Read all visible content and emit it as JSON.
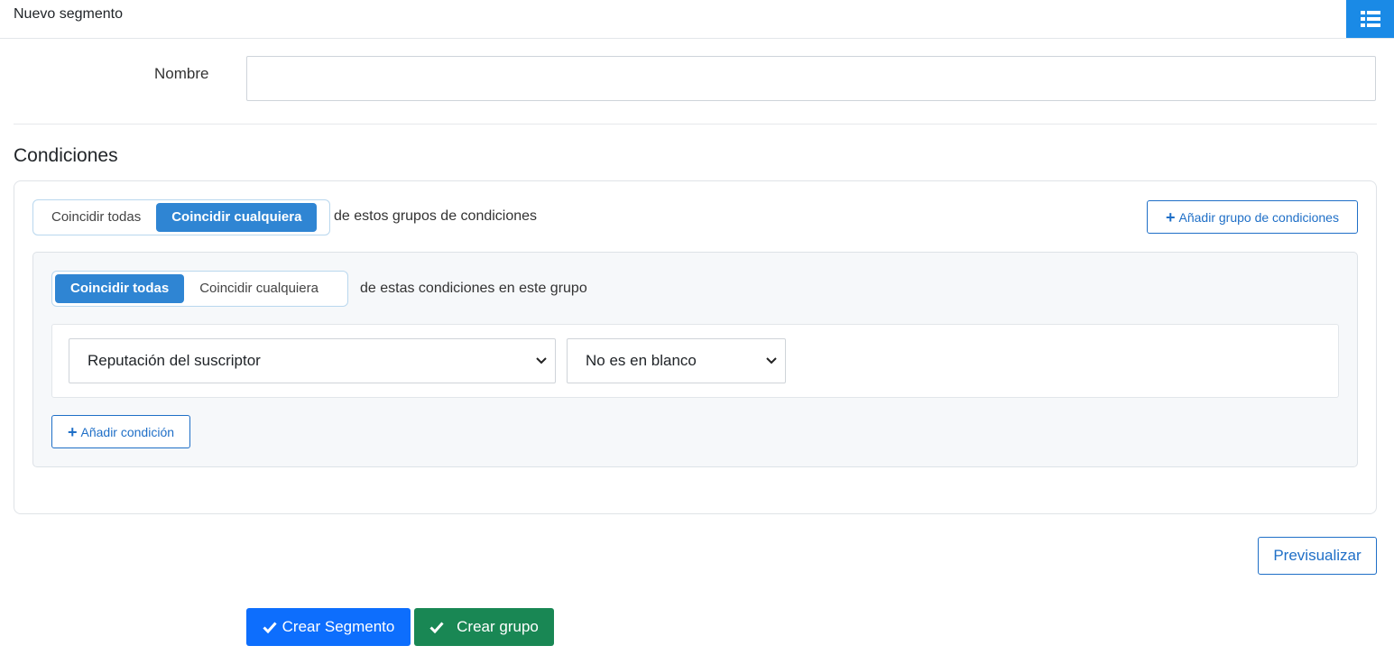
{
  "header": {
    "title": "Nuevo segmento",
    "list_icon": "list-view-icon",
    "accent": "#1a8ae6"
  },
  "form": {
    "name_label": "Nombre",
    "name_value": "",
    "name_placeholder": ""
  },
  "conditions": {
    "title": "Condiciones",
    "outer_toggle": {
      "options": [
        "Coincidir todas",
        "Coincidir cualquiera"
      ],
      "selected": "Coincidir cualquiera"
    },
    "outer_suffix": "de estos grupos de condiciones",
    "add_group_label": "Añadir grupo de condiciones",
    "group": {
      "toggle": {
        "options": [
          "Coincidir todas",
          "Coincidir cualquiera"
        ],
        "selected": "Coincidir todas"
      },
      "suffix": "de estas condiciones en este grupo",
      "condition": {
        "field": "Reputación del suscriptor",
        "operator": "No es en blanco"
      },
      "add_condition_label": "Añadir condición"
    }
  },
  "actions": {
    "preview_label": "Previsualizar",
    "create_segment_label": "Crear Segmento",
    "create_group_label": "Crear grupo",
    "primary_color": "#0d6efd",
    "success_color": "#198754"
  }
}
